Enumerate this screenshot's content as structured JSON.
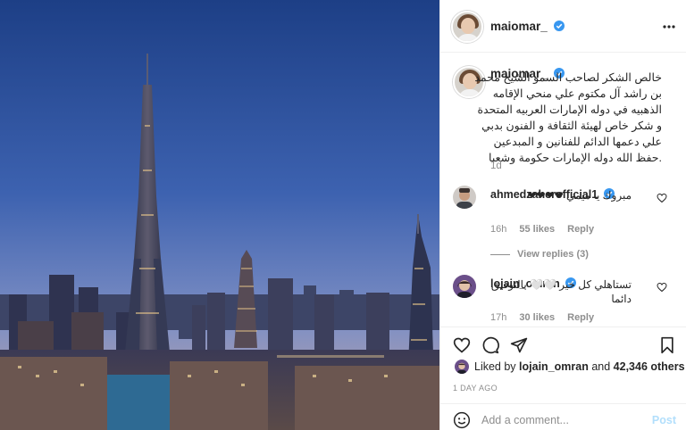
{
  "post": {
    "username": "maiomar_",
    "verified": true,
    "caption": "خالص الشكر لصاحب السمو الشيخ محمد بن راشد آل مكتوم علي منحي الإقامه الذهبيه في دوله الإمارات العربيه المتحدة و شكر خاص لهيئة الثقافة و الفنون بدبي علي دعمها الدائم للفنانين و المبدعين .حفظ الله دوله الإمارات حكومة وشعبا",
    "caption_time": "1d",
    "likes": {
      "prefix": "Liked by",
      "user": "lojain_omran",
      "connector": "and",
      "count": "42,346 others"
    },
    "date": "1 DAY AGO"
  },
  "comments": [
    {
      "username": "ahmedzaherofficial1",
      "text": "مبروك يا ميمي ❤❤❤❤",
      "time": "16h",
      "likes": "55 likes",
      "reply": "Reply",
      "view_replies": "View replies (3)"
    },
    {
      "username": "lojain_omran",
      "text": "تستاهلي كل خير 🤍🤍 بالتوفيق دائما",
      "time": "17h",
      "likes": "30 likes",
      "reply": "Reply"
    }
  ],
  "add_comment": {
    "placeholder": "Add a comment...",
    "post_label": "Post"
  },
  "icons": {
    "more": "more-horizontal-icon",
    "like": "heart-icon",
    "comment": "comment-bubble-icon",
    "share": "paper-plane-icon",
    "save": "bookmark-icon",
    "verified": "verified-badge-icon",
    "emoji": "smiley-icon"
  },
  "colors": {
    "verified": "#3897f0",
    "post_button_disabled": "#b2dffc",
    "muted_text": "#8e8e8e",
    "divider": "#efefef"
  }
}
